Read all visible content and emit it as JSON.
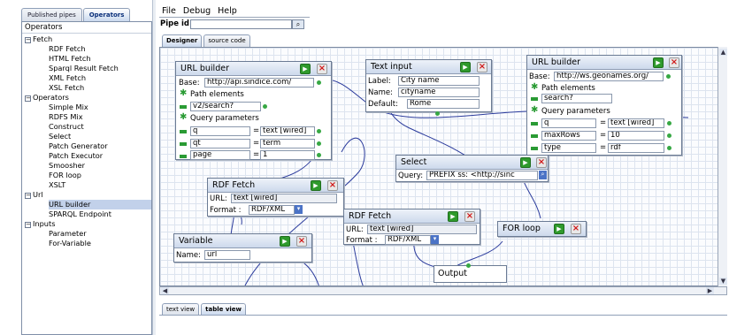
{
  "left_tabs": [
    "Published pipes",
    "Operators"
  ],
  "operators_header": "Operators",
  "tree": [
    {
      "label": "Fetch",
      "group": true,
      "toggle": "−"
    },
    {
      "label": "RDF Fetch"
    },
    {
      "label": "HTML Fetch"
    },
    {
      "label": "Sparql Result Fetch"
    },
    {
      "label": "XML Fetch"
    },
    {
      "label": "XSL Fetch"
    },
    {
      "label": "Operators",
      "group": true,
      "toggle": "−"
    },
    {
      "label": "Simple Mix"
    },
    {
      "label": "RDFS Mix"
    },
    {
      "label": "Construct"
    },
    {
      "label": "Select"
    },
    {
      "label": "Patch Generator"
    },
    {
      "label": "Patch Executor"
    },
    {
      "label": "Smoosher"
    },
    {
      "label": "FOR loop"
    },
    {
      "label": "XSLT"
    },
    {
      "label": "Url",
      "group": true,
      "toggle": "−"
    },
    {
      "label": "URL builder",
      "selected": true
    },
    {
      "label": "SPARQL Endpoint"
    },
    {
      "label": "Inputs",
      "group": true,
      "toggle": "−"
    },
    {
      "label": "Parameter"
    },
    {
      "label": "For-Variable"
    }
  ],
  "menu": [
    "File",
    "Debug",
    "Help"
  ],
  "pipe_id_label": "Pipe id",
  "editor_tabs": [
    "Designer",
    "source code"
  ],
  "bottom_tabs": [
    "text view",
    "table view"
  ],
  "modules": {
    "url1": {
      "title": "URL builder",
      "base_label": "Base:",
      "base": "http://api.sindice.com/",
      "path_label": "Path elements",
      "path": "v2/search?",
      "query_label": "Query parameters",
      "params": [
        {
          "k": "q",
          "v": "text [wired]"
        },
        {
          "k": "qt",
          "v": "term"
        },
        {
          "k": "page",
          "v": "1"
        }
      ]
    },
    "textinput": {
      "title": "Text input",
      "label_label": "Label:",
      "label": "City name",
      "name_label": "Name:",
      "name": "cityname",
      "default_label": "Default:",
      "default": "Rome"
    },
    "url2": {
      "title": "URL builder",
      "base_label": "Base:",
      "base": "http://ws.geonames.org/",
      "path_label": "Path elements",
      "path": "search?",
      "query_label": "Query parameters",
      "params": [
        {
          "k": "q",
          "v": "text [wired]"
        },
        {
          "k": "maxRows",
          "v": "10"
        },
        {
          "k": "type",
          "v": "rdf"
        }
      ]
    },
    "select": {
      "title": "Select",
      "query_label": "Query:",
      "query": "PREFIX ss: <http://sinc"
    },
    "rdf1": {
      "title": "RDF Fetch",
      "url_label": "URL:",
      "url": "text [wired]",
      "format_label": "Format :",
      "format": "RDF/XML"
    },
    "rdf2": {
      "title": "RDF Fetch",
      "url_label": "URL:",
      "url": "text [wired]",
      "format_label": "Format :",
      "format": "RDF/XML"
    },
    "forloop": {
      "title": "FOR loop"
    },
    "variable": {
      "title": "Variable",
      "name_label": "Name:",
      "name": "url"
    },
    "output": {
      "title": "Output"
    }
  },
  "colors": {
    "accent_green": "#2f9a2c",
    "close_red": "#d01616",
    "wire_blue": "#2b3b9c",
    "grid": "#dde4ef"
  }
}
